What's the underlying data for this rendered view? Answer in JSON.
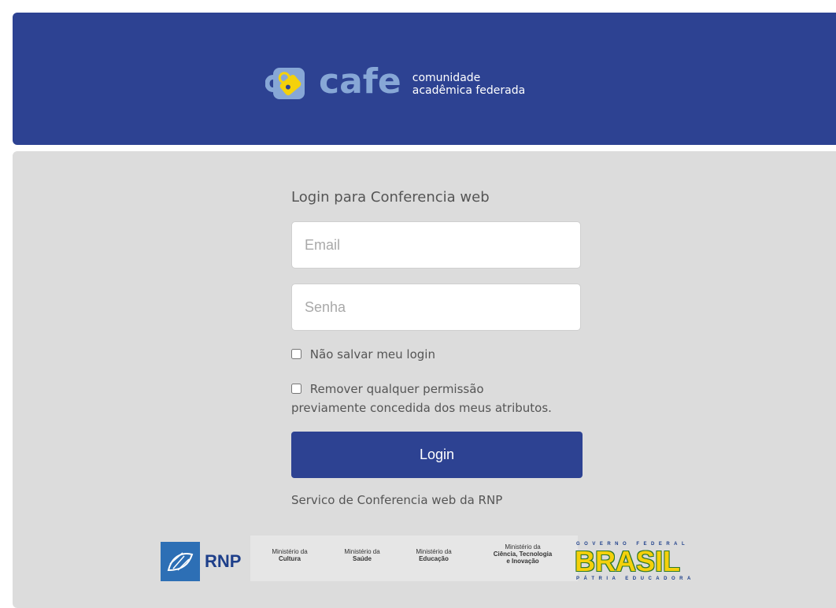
{
  "header": {
    "logo_word": "cafe",
    "logo_tag_line1": "comunidade",
    "logo_tag_line2": "acadêmica federada",
    "background_color": "#2d4292"
  },
  "login": {
    "title": "Login para Conferencia web",
    "email_placeholder": "Email",
    "email_value": "",
    "password_placeholder": "Senha",
    "password_value": "",
    "checkbox_no_save_label": "Não salvar meu login",
    "checkbox_no_save_checked": false,
    "checkbox_revoke_label_line1": "Remover qualquer permissão",
    "checkbox_revoke_label_line2": "previamente concedida dos meus atributos.",
    "checkbox_revoke_checked": false,
    "button_label": "Login",
    "service_text": "Servico de Conferencia web da RNP"
  },
  "footer": {
    "rnp_label": "RNP",
    "ministries": [
      {
        "line1": "Ministério da",
        "line2": "Cultura"
      },
      {
        "line1": "Ministério da",
        "line2": "Saúde"
      },
      {
        "line1": "Ministério da",
        "line2": "Educação"
      },
      {
        "line1": "Ministério da",
        "line2": "Ciência, Tecnologia",
        "line3": "e Inovação"
      }
    ],
    "gov_top": "GOVERNO FEDERAL",
    "gov_word": "BRASIL",
    "gov_bottom": "PÁTRIA EDUCADORA"
  },
  "colors": {
    "accent": "#2d4292",
    "panel": "#dcdcdc",
    "text": "#555555"
  }
}
